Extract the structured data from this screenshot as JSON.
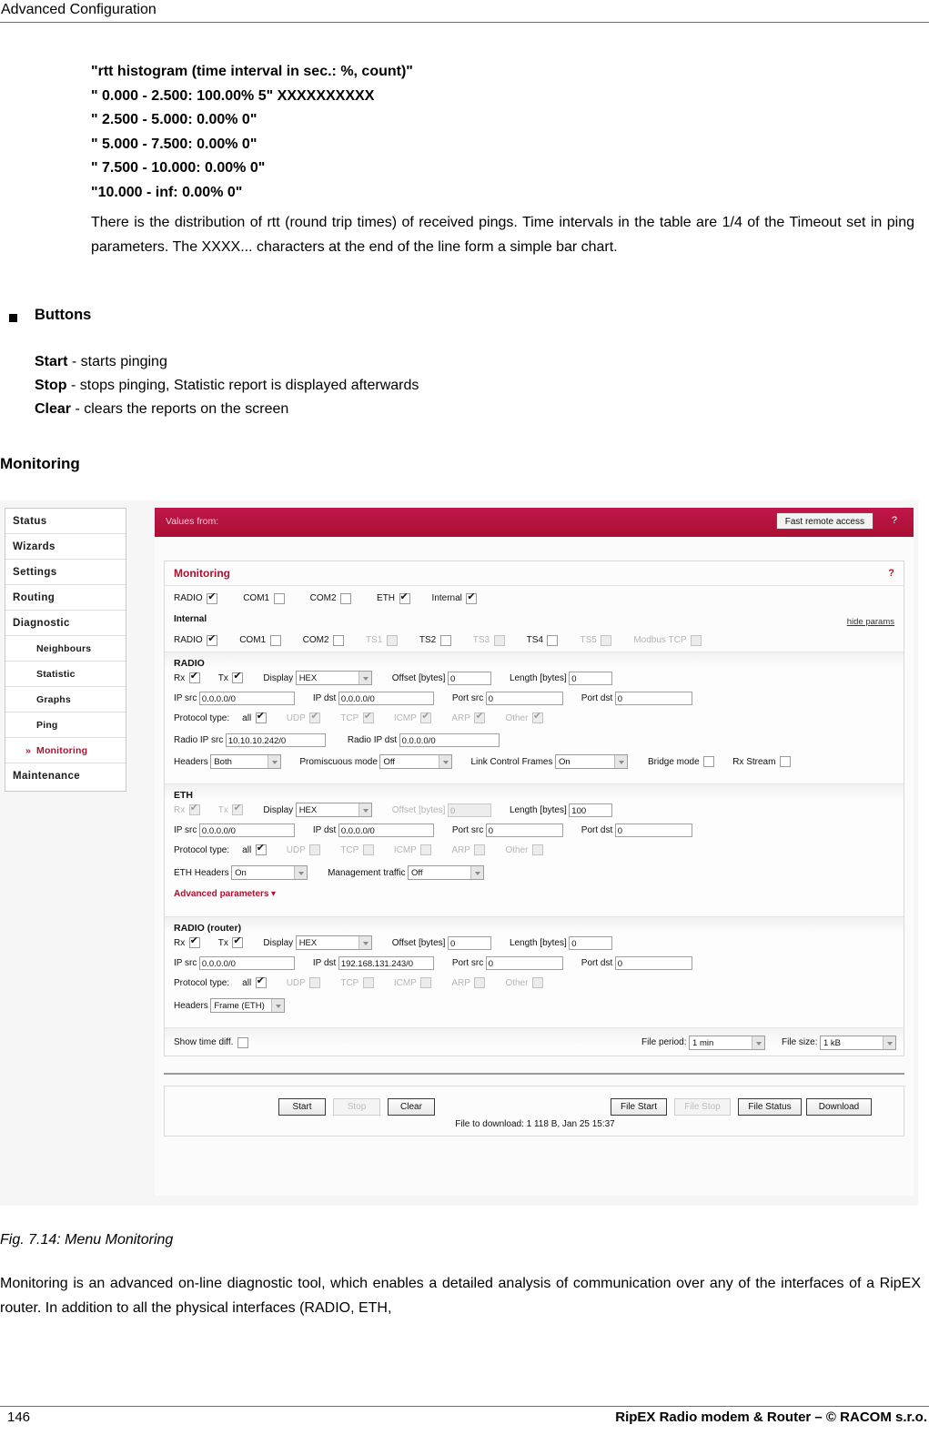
{
  "page": {
    "header": "Advanced Configuration",
    "footer_page_number": "146",
    "footer_note": "RipEX Radio modem & Router – © RACOM s.r.o."
  },
  "histogram_block": [
    "\"rtt histogram (time interval in sec.: %, count)\"",
    "\" 0.000 - 2.500: 100.00% 5\" XXXXXXXXXX",
    "\" 2.500 - 5.000: 0.00% 0\"",
    "\" 5.000 - 7.500: 0.00% 0\"",
    "\" 7.500 - 10.000: 0.00% 0\"",
    "\"10.000 - inf: 0.00% 0\""
  ],
  "paragraph_1": "There is the distribution of rtt (round trip times) of received pings. Time intervals in the table are 1/4 of the Timeout set in ping parameters. The XXXX... characters at the end of the line form a simple bar chart.",
  "buttons_heading": "Buttons",
  "button_descriptions": [
    {
      "name": "Start",
      "text": " - starts pinging"
    },
    {
      "name": "Stop",
      "text": " - stops pinging, Statistic report is displayed afterwards"
    },
    {
      "name": "Clear",
      "text": " - clears the reports on the screen"
    }
  ],
  "section_heading": "Monitoring",
  "figure_caption": "Fig. 7.14: Menu Monitoring",
  "paragraph_2": "Monitoring is an advanced on-line diagnostic tool, which enables a detailed analysis of communication over any of the interfaces of a RipEX router. In addition to all the physical interfaces (RADIO, ETH,",
  "colors": {
    "brand_red": "#b5123c",
    "accent_red": "#b01030",
    "panel_bg": "#fcfcfc"
  },
  "screenshot": {
    "sidebar": {
      "items": [
        {
          "label": "Status",
          "level": "top",
          "active": false
        },
        {
          "label": "Wizards",
          "level": "top",
          "active": false
        },
        {
          "label": "Settings",
          "level": "top",
          "active": false
        },
        {
          "label": "Routing",
          "level": "top",
          "active": false
        },
        {
          "label": "Diagnostic",
          "level": "top",
          "active": false
        },
        {
          "label": "Neighbours",
          "level": "sub",
          "active": false
        },
        {
          "label": "Statistic",
          "level": "sub",
          "active": false
        },
        {
          "label": "Graphs",
          "level": "sub",
          "active": false
        },
        {
          "label": "Ping",
          "level": "sub",
          "active": false
        },
        {
          "label": "Monitoring",
          "level": "sub",
          "active": true,
          "marker": "»"
        },
        {
          "label": "Maintenance",
          "level": "top",
          "active": false
        }
      ]
    },
    "topbar": {
      "values_from_label": "Values from:",
      "fast_remote_access": "Fast remote access",
      "help": "?"
    },
    "panel": {
      "title": "Monitoring",
      "help": "?",
      "hide_params": "hide params",
      "interfaces_row": [
        {
          "label": "RADIO",
          "checked": true,
          "disabled": false
        },
        {
          "label": "COM1",
          "checked": false,
          "disabled": false
        },
        {
          "label": "COM2",
          "checked": false,
          "disabled": false
        },
        {
          "label": "ETH",
          "checked": true,
          "disabled": false
        },
        {
          "label": "Internal",
          "checked": true,
          "disabled": false
        }
      ],
      "internal_label": "Internal",
      "internal_row": [
        {
          "label": "RADIO",
          "checked": true,
          "disabled": false
        },
        {
          "label": "COM1",
          "checked": false,
          "disabled": false
        },
        {
          "label": "COM2",
          "checked": false,
          "disabled": false
        },
        {
          "label": "TS1",
          "checked": false,
          "disabled": true
        },
        {
          "label": "TS2",
          "checked": false,
          "disabled": false
        },
        {
          "label": "TS3",
          "checked": false,
          "disabled": true
        },
        {
          "label": "TS4",
          "checked": false,
          "disabled": false
        },
        {
          "label": "TS5",
          "checked": false,
          "disabled": true
        },
        {
          "label": "Modbus TCP",
          "checked": false,
          "disabled": true
        }
      ],
      "sections": [
        {
          "title": "RADIO",
          "rx": {
            "label": "Rx",
            "checked": true,
            "disabled": false
          },
          "tx": {
            "label": "Tx",
            "checked": true,
            "disabled": false
          },
          "display": {
            "label": "Display",
            "value": "HEX"
          },
          "offset": {
            "label": "Offset [bytes]",
            "value": "0",
            "disabled": false
          },
          "length": {
            "label": "Length [bytes]",
            "value": "0",
            "disabled": false
          },
          "ip_src": {
            "label": "IP src",
            "value": "0.0.0.0/0"
          },
          "ip_dst": {
            "label": "IP dst",
            "value": "0.0.0.0/0"
          },
          "port_src": {
            "label": "Port src",
            "value": "0"
          },
          "port_dst": {
            "label": "Port dst",
            "value": "0"
          },
          "protocol_label": "Protocol type:",
          "protocols": [
            {
              "label": "all",
              "checked": true,
              "disabled": false
            },
            {
              "label": "UDP",
              "checked": true,
              "disabled": true
            },
            {
              "label": "TCP",
              "checked": true,
              "disabled": true
            },
            {
              "label": "ICMP",
              "checked": true,
              "disabled": true
            },
            {
              "label": "ARP",
              "checked": true,
              "disabled": true
            },
            {
              "label": "Other",
              "checked": true,
              "disabled": true
            }
          ],
          "radio_ip_src": {
            "label": "Radio IP src",
            "value": "10.10.10.242/0"
          },
          "radio_ip_dst": {
            "label": "Radio IP dst",
            "value": "0.0.0.0/0"
          },
          "headers": {
            "label": "Headers",
            "value": "Both"
          },
          "promiscuous": {
            "label": "Promiscuous mode",
            "value": "Off"
          },
          "link_control": {
            "label": "Link Control Frames",
            "value": "On"
          },
          "bridge_mode": {
            "label": "Bridge mode",
            "checked": false
          },
          "rx_stream": {
            "label": "Rx Stream",
            "checked": false
          }
        },
        {
          "title": "ETH",
          "rx": {
            "label": "Rx",
            "checked": true,
            "disabled": true
          },
          "tx": {
            "label": "Tx",
            "checked": true,
            "disabled": true
          },
          "display": {
            "label": "Display",
            "value": "HEX"
          },
          "offset": {
            "label": "Offset [bytes]",
            "value": "0",
            "disabled": true
          },
          "length": {
            "label": "Length [bytes]",
            "value": "100",
            "disabled": false
          },
          "ip_src": {
            "label": "IP src",
            "value": "0.0.0.0/0"
          },
          "ip_dst": {
            "label": "IP dst",
            "value": "0.0.0.0/0"
          },
          "port_src": {
            "label": "Port src",
            "value": "0"
          },
          "port_dst": {
            "label": "Port dst",
            "value": "0"
          },
          "protocol_label": "Protocol type:",
          "protocols": [
            {
              "label": "all",
              "checked": true,
              "disabled": false
            },
            {
              "label": "UDP",
              "checked": false,
              "disabled": true
            },
            {
              "label": "TCP",
              "checked": false,
              "disabled": true
            },
            {
              "label": "ICMP",
              "checked": false,
              "disabled": true
            },
            {
              "label": "ARP",
              "checked": false,
              "disabled": true
            },
            {
              "label": "Other",
              "checked": false,
              "disabled": true
            }
          ],
          "eth_headers": {
            "label": "ETH Headers",
            "value": "On"
          },
          "management_traffic": {
            "label": "Management traffic",
            "value": "Off"
          },
          "advanced_parameters": "Advanced parameters"
        },
        {
          "title": "RADIO (router)",
          "rx": {
            "label": "Rx",
            "checked": true,
            "disabled": false
          },
          "tx": {
            "label": "Tx",
            "checked": true,
            "disabled": false
          },
          "display": {
            "label": "Display",
            "value": "HEX"
          },
          "offset": {
            "label": "Offset [bytes]",
            "value": "0",
            "disabled": false
          },
          "length": {
            "label": "Length [bytes]",
            "value": "0",
            "disabled": false
          },
          "ip_src": {
            "label": "IP src",
            "value": "0.0.0.0/0"
          },
          "ip_dst": {
            "label": "IP dst",
            "value": "192.168.131.243/0"
          },
          "port_src": {
            "label": "Port src",
            "value": "0"
          },
          "port_dst": {
            "label": "Port dst",
            "value": "0"
          },
          "protocol_label": "Protocol type:",
          "protocols": [
            {
              "label": "all",
              "checked": true,
              "disabled": false
            },
            {
              "label": "UDP",
              "checked": false,
              "disabled": true
            },
            {
              "label": "TCP",
              "checked": false,
              "disabled": true
            },
            {
              "label": "ICMP",
              "checked": false,
              "disabled": true
            },
            {
              "label": "ARP",
              "checked": false,
              "disabled": true
            },
            {
              "label": "Other",
              "checked": false,
              "disabled": true
            }
          ],
          "headers": {
            "label": "Headers",
            "value": "Frame (ETH)"
          }
        }
      ],
      "footer_row": {
        "show_time_diff": {
          "label": "Show time diff.",
          "checked": false
        },
        "file_period": {
          "label": "File period:",
          "value": "1 min"
        },
        "file_size": {
          "label": "File size:",
          "value": "1 kB"
        }
      }
    },
    "action_buttons": [
      {
        "label": "Start",
        "disabled": false
      },
      {
        "label": "Stop",
        "disabled": true
      },
      {
        "label": "Clear",
        "disabled": false
      },
      {
        "label": "File Start",
        "disabled": false
      },
      {
        "label": "File Stop",
        "disabled": true
      },
      {
        "label": "File Status",
        "disabled": false
      },
      {
        "label": "Download",
        "disabled": false
      }
    ],
    "download_note": "File to download: 1 118 B, Jan 25 15:37"
  }
}
